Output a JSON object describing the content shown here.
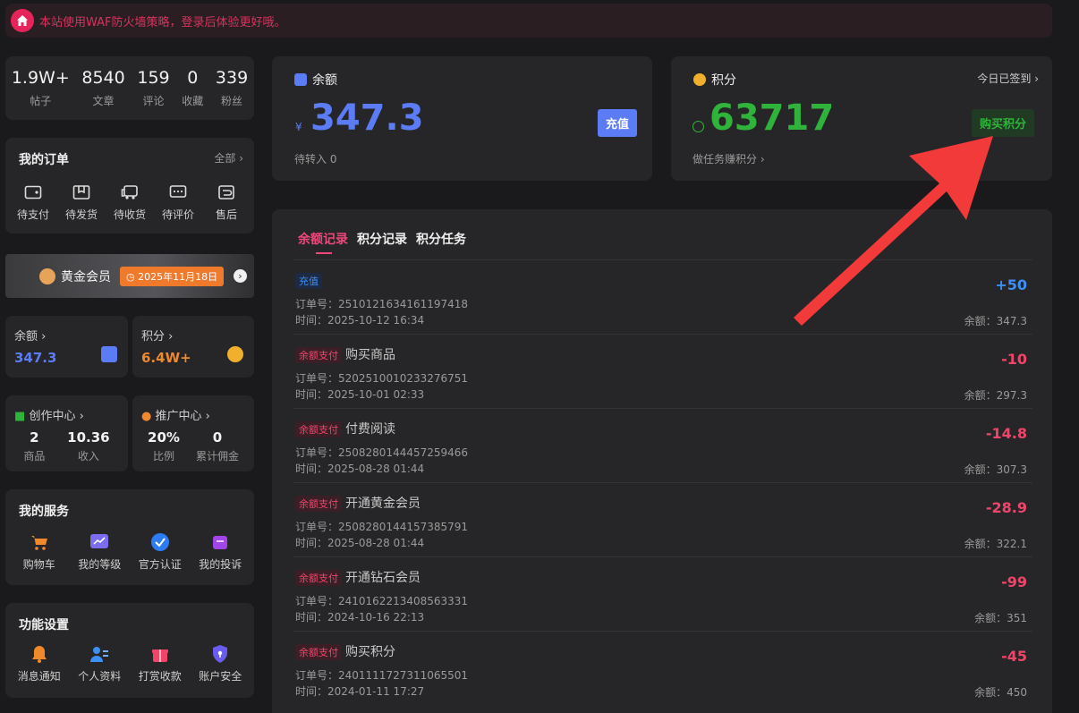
{
  "notice": {
    "text": "本站使用WAF防火墙策略，登录后体验更好哦。"
  },
  "stats": [
    {
      "value": "1.9W+",
      "label": "帖子"
    },
    {
      "value": "8540",
      "label": "文章"
    },
    {
      "value": "159",
      "label": "评论"
    },
    {
      "value": "0",
      "label": "收藏"
    },
    {
      "value": "339",
      "label": "粉丝"
    }
  ],
  "orders": {
    "title": "我的订单",
    "all": "全部",
    "items": [
      "待支付",
      "待发货",
      "待收货",
      "待评价",
      "售后"
    ]
  },
  "vip": {
    "name": "黄金会员",
    "expire": "2025年11月18日"
  },
  "mini_balance": {
    "title": "余额",
    "value": "347.3"
  },
  "mini_points": {
    "title": "积分",
    "value": "6.4W+"
  },
  "creator": {
    "title": "创作中心",
    "stats": [
      {
        "value": "2",
        "label": "商品"
      },
      {
        "value": "10.36",
        "label": "收入"
      }
    ]
  },
  "promo": {
    "title": "推广中心",
    "stats": [
      {
        "value": "20%",
        "label": "比例"
      },
      {
        "value": "0",
        "label": "累计佣金"
      }
    ]
  },
  "services": {
    "title": "我的服务",
    "items": [
      "购物车",
      "我的等级",
      "官方认证",
      "我的投诉"
    ]
  },
  "settings": {
    "title": "功能设置",
    "items": [
      "消息通知",
      "个人资料",
      "打赏收款",
      "账户安全"
    ]
  },
  "balance_card": {
    "title": "余额",
    "currency": "¥",
    "amount": "347.3",
    "button": "充值",
    "pending": "待转入 0"
  },
  "points_card": {
    "title": "积分",
    "signin": "今日已签到",
    "amount": "63717",
    "button": "购买积分",
    "task": "做任务赚积分"
  },
  "tabs": [
    "余额记录",
    "积分记录",
    "积分任务"
  ],
  "records": [
    {
      "badge": "充值",
      "name": "",
      "order": "订单号：2510121634161197418",
      "time": "时间：2025-10-12 16:34",
      "amount": "+50",
      "after": "余额：347.3"
    },
    {
      "badge": "余额支付",
      "name": "购买商品",
      "order": "订单号：5202510010233276751",
      "time": "时间：2025-10-01 02:33",
      "amount": "-10",
      "after": "余额：297.3"
    },
    {
      "badge": "余额支付",
      "name": "付费阅读",
      "order": "订单号：2508280144457259466",
      "time": "时间：2025-08-28 01:44",
      "amount": "-14.8",
      "after": "余额：307.3"
    },
    {
      "badge": "余额支付",
      "name": "开通黄金会员",
      "order": "订单号：2508280144157385791",
      "time": "时间：2025-08-28 01:44",
      "amount": "-28.9",
      "after": "余额：322.1"
    },
    {
      "badge": "余额支付",
      "name": "开通钻石会员",
      "order": "订单号：2410162213408563331",
      "time": "时间：2024-10-16 22:13",
      "amount": "-99",
      "after": "余额：351"
    },
    {
      "badge": "余额支付",
      "name": "购买积分",
      "order": "订单号：2401111727311065501",
      "time": "时间：2024-01-11 17:27",
      "amount": "-45",
      "after": "余额：450"
    }
  ],
  "colors": {
    "accent_blue": "#5b7cf5",
    "green": "#2fb33a",
    "positive": "#3b8ff5",
    "negative": "#f0456a",
    "orange": "#f0882c",
    "arrow": "#f23a3a"
  }
}
